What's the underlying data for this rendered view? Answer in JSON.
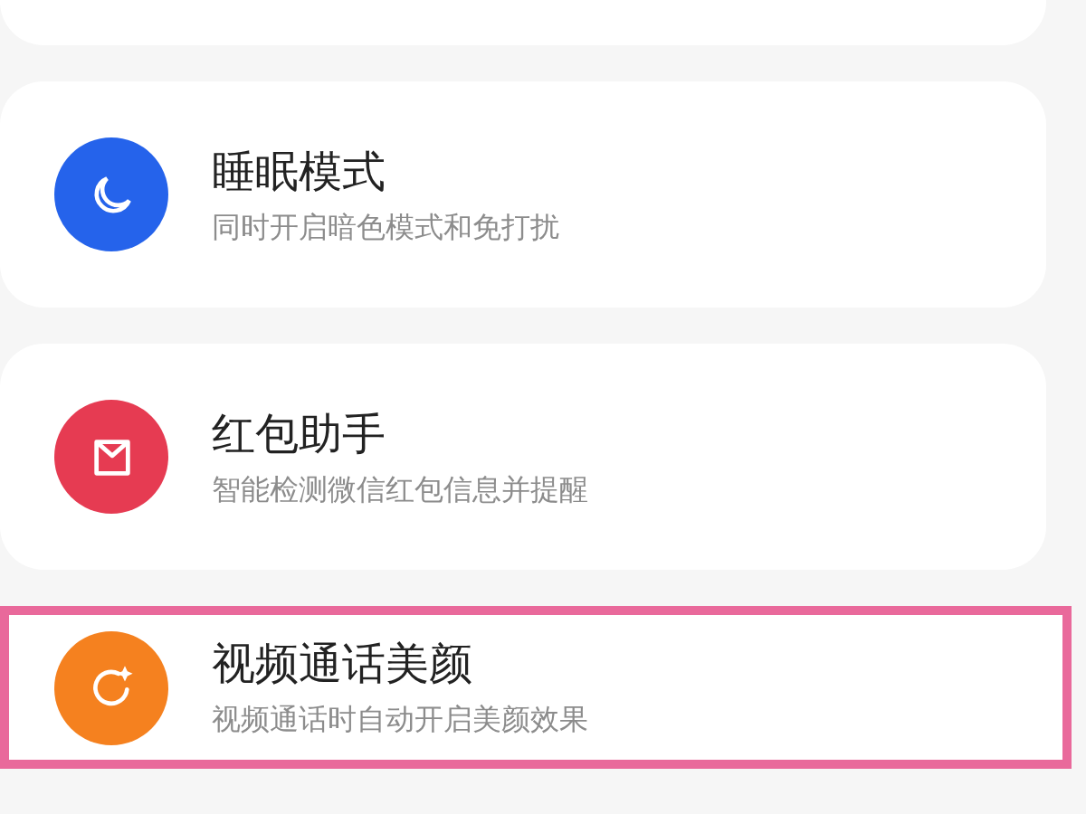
{
  "items": [
    {
      "kind": "moon",
      "color": "#2563eb",
      "title": "睡眠模式",
      "subtitle": "同时开启暗色模式和免打扰",
      "highlighted": false
    },
    {
      "kind": "envelope",
      "color": "#e63b52",
      "title": "红包助手",
      "subtitle": "智能检测微信红包信息并提醒",
      "highlighted": false
    },
    {
      "kind": "sparkle",
      "color": "#f5811f",
      "title": "视频通话美颜",
      "subtitle": "视频通话时自动开启美颜效果",
      "highlighted": true
    }
  ]
}
